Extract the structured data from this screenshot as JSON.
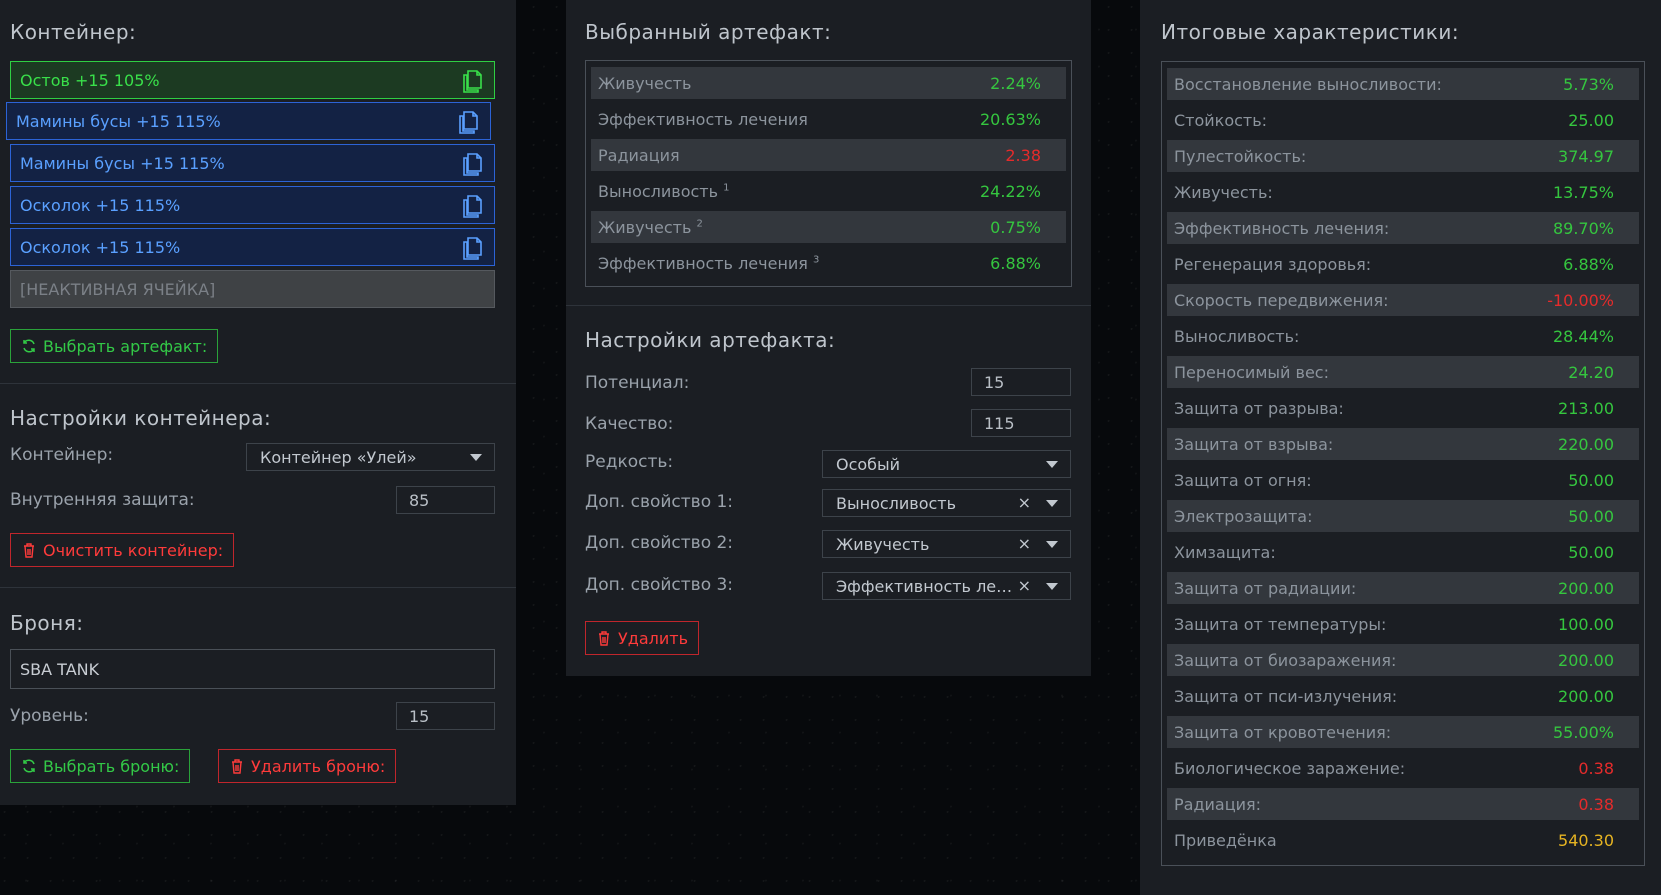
{
  "left": {
    "container_title": "Контейнер:",
    "slots": [
      {
        "label": "Остов +15 105%",
        "style": "green"
      },
      {
        "label": "Мамины бусы +15 115%",
        "style": "blue"
      },
      {
        "label": "Мамины бусы +15 115%",
        "style": "blue"
      },
      {
        "label": "Осколок +15 115%",
        "style": "blue"
      },
      {
        "label": "Осколок +15 115%",
        "style": "blue"
      }
    ],
    "inactive_slot": "[НЕАКТИВНАЯ ЯЧЕЙКА]",
    "choose_artifact": "Выбрать артефакт:",
    "settings_title": "Настройки контейнера:",
    "container_label": "Контейнер:",
    "container_value": "Контейнер «Улей»",
    "inner_protection_label": "Внутренняя защита:",
    "inner_protection_value": "85",
    "clear_container": "Очистить контейнер:",
    "armor_title": "Броня:",
    "armor_value": "SBA TANK",
    "level_label": "Уровень:",
    "level_value": "15",
    "choose_armor": "Выбрать броню:",
    "delete_armor": "Удалить броню:"
  },
  "mid": {
    "selected_title": "Выбранный артефакт:",
    "stats": [
      {
        "name": "Живучесть",
        "sup": "",
        "value": "2.24%",
        "tone": "pos"
      },
      {
        "name": "Эффективность лечения",
        "sup": "",
        "value": "20.63%",
        "tone": "pos"
      },
      {
        "name": "Радиация",
        "sup": "",
        "value": "2.38",
        "tone": "neg"
      },
      {
        "name": "Выносливость",
        "sup": "1",
        "value": "24.22%",
        "tone": "pos"
      },
      {
        "name": "Живучесть",
        "sup": "2",
        "value": "0.75%",
        "tone": "pos"
      },
      {
        "name": "Эффективность лечения",
        "sup": "3",
        "value": "6.88%",
        "tone": "pos"
      }
    ],
    "settings_title": "Настройки артефакта:",
    "potential_label": "Потенциал:",
    "potential_value": "15",
    "quality_label": "Качество:",
    "quality_value": "115",
    "rarity_label": "Редкость:",
    "rarity_value": "Особый",
    "prop1_label": "Доп. свойство 1:",
    "prop1_value": "Выносливость",
    "prop2_label": "Доп. свойство 2:",
    "prop2_value": "Живучесть",
    "prop3_label": "Доп. свойство 3:",
    "prop3_value": "Эффективность ле…",
    "clear_glyph": "×",
    "delete": "Удалить"
  },
  "right": {
    "title": "Итоговые характеристики:",
    "stats": [
      {
        "name": "Восстановление выносливости:",
        "value": "5.73%",
        "tone": "pos"
      },
      {
        "name": "Стойкость:",
        "value": "25.00",
        "tone": "pos"
      },
      {
        "name": "Пулестойкость:",
        "value": "374.97",
        "tone": "pos"
      },
      {
        "name": "Живучесть:",
        "value": "13.75%",
        "tone": "pos"
      },
      {
        "name": "Эффективность лечения:",
        "value": "89.70%",
        "tone": "pos"
      },
      {
        "name": "Регенерация здоровья:",
        "value": "6.88%",
        "tone": "pos"
      },
      {
        "name": "Скорость передвижения:",
        "value": "-10.00%",
        "tone": "neg"
      },
      {
        "name": "Выносливость:",
        "value": "28.44%",
        "tone": "pos"
      },
      {
        "name": "Переносимый вес:",
        "value": "24.20",
        "tone": "pos"
      },
      {
        "name": "Защита от разрыва:",
        "value": "213.00",
        "tone": "pos"
      },
      {
        "name": "Защита от взрыва:",
        "value": "220.00",
        "tone": "pos"
      },
      {
        "name": "Защита от огня:",
        "value": "50.00",
        "tone": "pos"
      },
      {
        "name": "Электрозащита:",
        "value": "50.00",
        "tone": "pos"
      },
      {
        "name": "Химзащита:",
        "value": "50.00",
        "tone": "pos"
      },
      {
        "name": "Защита от радиации:",
        "value": "200.00",
        "tone": "pos"
      },
      {
        "name": "Защита от температуры:",
        "value": "100.00",
        "tone": "pos"
      },
      {
        "name": "Защита от биозаражения:",
        "value": "200.00",
        "tone": "pos"
      },
      {
        "name": "Защита от пси-излучения:",
        "value": "200.00",
        "tone": "pos"
      },
      {
        "name": "Защита от кровотечения:",
        "value": "55.00%",
        "tone": "pos"
      },
      {
        "name": "Биологическое заражение:",
        "value": "0.38",
        "tone": "neg"
      },
      {
        "name": "Радиация:",
        "value": "0.38",
        "tone": "neg"
      },
      {
        "name": "Приведёнка",
        "value": "540.30",
        "tone": "gold"
      }
    ]
  },
  "icons": {
    "copy": "copy-icon",
    "refresh": "refresh-icon",
    "trash": "trash-icon",
    "dropdown": "chevron-down-icon",
    "clear": "close-icon"
  },
  "colors": {
    "positive": "#35c63f",
    "negative": "#e52b2b",
    "gold": "#e6b422",
    "panel": "#1b1e23"
  }
}
